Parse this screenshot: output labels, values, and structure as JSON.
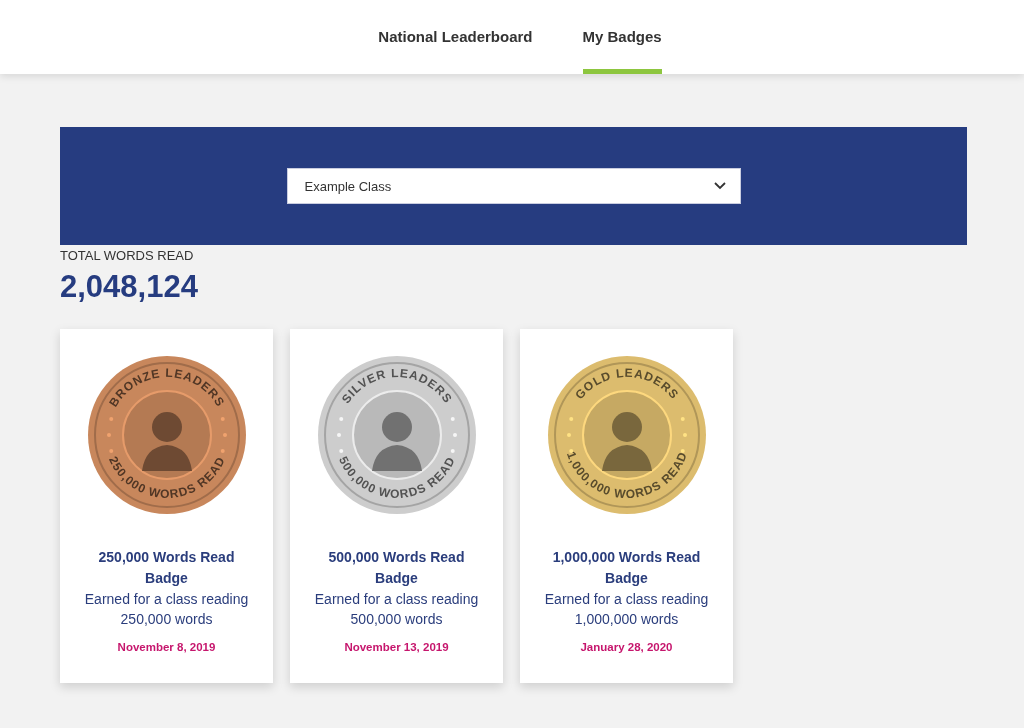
{
  "tabs": [
    {
      "label": "National Leaderboard",
      "selected": false
    },
    {
      "label": "My Badges",
      "selected": true
    }
  ],
  "class_select": {
    "value": "Example Class"
  },
  "total": {
    "label": "TOTAL WORDS READ",
    "value": "2,048,124"
  },
  "badges": [
    {
      "coin_top": "BRONZE LEADERS",
      "coin_bottom": "250,000 WORDS READ",
      "color": "#c8875c",
      "title": "250,000 Words Read Badge",
      "description": "Earned for a class reading 250,000 words",
      "date": "November 8, 2019"
    },
    {
      "coin_top": "SILVER LEADERS",
      "coin_bottom": "500,000 WORDS READ",
      "color": "#cdcdcd",
      "title": "500,000 Words Read Badge",
      "description": "Earned for a class reading 500,000 words",
      "date": "November 13, 2019"
    },
    {
      "coin_top": "GOLD LEADERS",
      "coin_bottom": "1,000,000 WORDS READ",
      "color": "#dcbc6e",
      "title": "1,000,000 Words Read Badge",
      "description": "Earned for a class reading 1,000,000 words",
      "date": "January 28, 2020"
    }
  ]
}
